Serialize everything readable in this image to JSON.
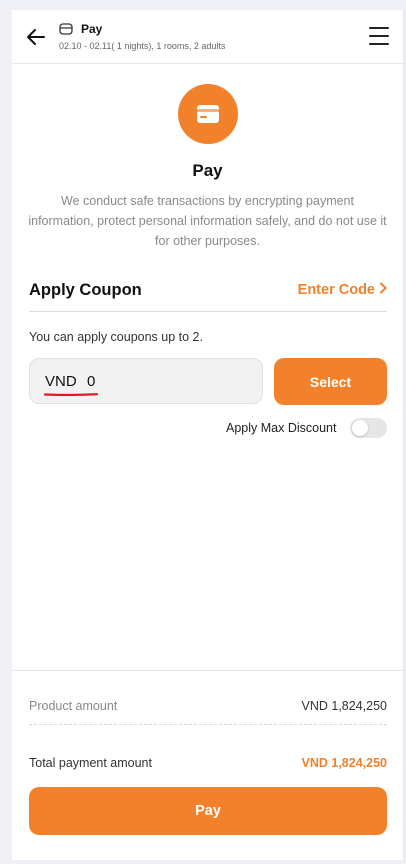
{
  "header": {
    "title": "Pay",
    "subtitle": "02.10 - 02.11( 1 nights), 1 rooms, 2 adults",
    "back_icon": "arrow-left-icon",
    "menu_icon": "hamburger-menu-icon",
    "hotel_icon": "hotel-icon"
  },
  "payment": {
    "icon": "credit-card-icon",
    "title": "Pay",
    "description": "We conduct safe transactions by encrypting payment information, protect personal information safely, and do not use it for other purposes."
  },
  "coupon": {
    "title": "Apply Coupon",
    "enter_code": "Enter Code",
    "note": "You can apply coupons up to 2.",
    "currency": "VND",
    "value": "0",
    "select_label": "Select",
    "max_discount_label": "Apply Max Discount",
    "max_discount_on": false
  },
  "summary": {
    "product_label": "Product amount",
    "product_value": "VND 1,824,250",
    "total_label": "Total payment amount",
    "total_value": "VND 1,824,250",
    "pay_label": "Pay"
  },
  "colors": {
    "accent": "#f2812c",
    "annotation": "#e0191f"
  }
}
